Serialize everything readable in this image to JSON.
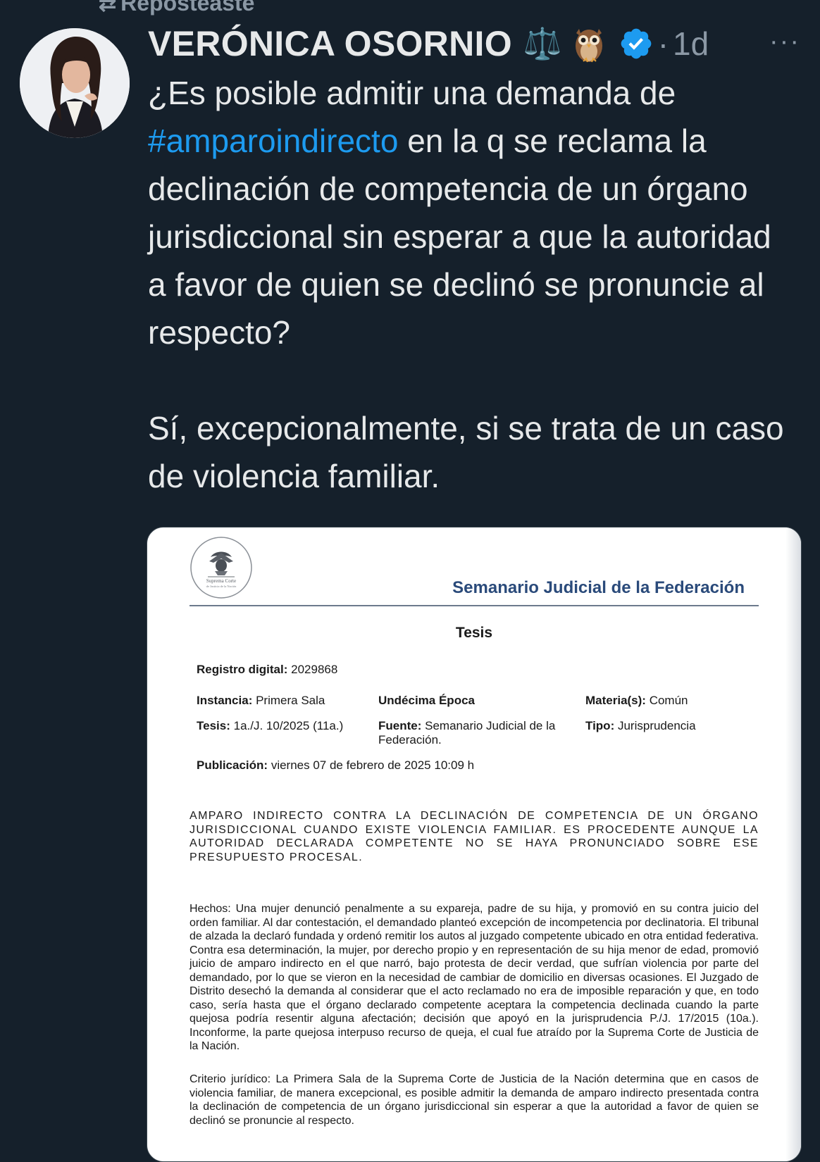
{
  "repost": {
    "label": "Reposteaste"
  },
  "author": {
    "name": "VERÓNICA OSORNIO",
    "scales_emoji": "⚖️",
    "owl_icon": "owl-icon",
    "verified_icon": "verified-badge-icon",
    "separator": "·",
    "time": "1d"
  },
  "menu": {
    "more_label": "···"
  },
  "tweet": {
    "text_before_hashtag": "¿Es posible admitir una demanda de",
    "hashtag": "#amparoindirecto",
    "text_after_hashtag": "en la q se reclama la declinación de competencia de un órgano jurisdiccional sin esperar a que la autoridad a favor de quien se declinó se pronuncie al respecto?",
    "answer": "Sí, excepcionalmente, si se trata de un caso de violencia familiar."
  },
  "colors": {
    "background": "#15202b",
    "hashtag": "#1d9bf0",
    "muted": "#8b98a5",
    "verified": "#1d9bf0"
  },
  "document": {
    "seal_text_1": "Suprema Corte",
    "seal_text_2": "de Justicia de la Nación",
    "header_title": "Semanario Judicial de la Federación",
    "heading": "Tesis",
    "registro_label": "Registro digital:",
    "registro_value": "2029868",
    "instancia_label": "Instancia:",
    "instancia_value": "Primera Sala",
    "epoca": "Undécima Época",
    "materia_label": "Materia(s):",
    "materia_value": "Común",
    "tesis_label": "Tesis:",
    "tesis_value": "1a./J. 10/2025 (11a.)",
    "fuente_label": "Fuente:",
    "fuente_value": "Semanario Judicial de la Federación.",
    "tipo_label": "Tipo:",
    "tipo_value": "Jurisprudencia",
    "publicacion_label": "Publicación:",
    "publicacion_value": "viernes 07 de febrero de 2025 10:09 h",
    "rubro": "AMPARO INDIRECTO CONTRA LA DECLINACIÓN DE COMPETENCIA DE UN ÓRGANO JURISDICCIONAL CUANDO EXISTE VIOLENCIA FAMILIAR. ES PROCEDENTE AUNQUE LA AUTORIDAD DECLARADA COMPETENTE NO SE HAYA PRONUNCIADO SOBRE ESE PRESUPUESTO PROCESAL.",
    "hechos": "Hechos: Una mujer denunció penalmente a su expareja, padre de su hija, y promovió en su contra juicio del orden familiar. Al dar contestación, el demandado planteó excepción de incompetencia por declinatoria. El tribunal de alzada la declaró fundada y ordenó remitir los autos al juzgado competente ubicado en otra entidad federativa. Contra esa determinación, la mujer, por derecho propio y en representación de su hija menor de edad, promovió juicio de amparo indirecto en el que narró, bajo protesta de decir verdad, que sufrían violencia por parte del demandado, por lo que se vieron en la necesidad de cambiar de domicilio en diversas ocasiones. El Juzgado de Distrito desechó la demanda al considerar que el acto reclamado no era de imposible reparación y que, en todo caso, sería hasta que el órgano declarado competente aceptara la competencia declinada cuando la parte quejosa podría resentir alguna afectación; decisión que apoyó en la jurisprudencia P./J. 17/2015 (10a.). Inconforme, la parte quejosa interpuso recurso de queja, el cual fue atraído por la Suprema Corte de Justicia de la Nación.",
    "criterio": "Criterio jurídico: La Primera Sala de la Suprema Corte de Justicia de la Nación determina que en casos de violencia familiar, de manera excepcional, es posible admitir la demanda de amparo indirecto presentada contra la declinación de competencia de un órgano jurisdiccional sin esperar a que la autoridad a favor de quien se declinó se pronuncie al respecto."
  }
}
